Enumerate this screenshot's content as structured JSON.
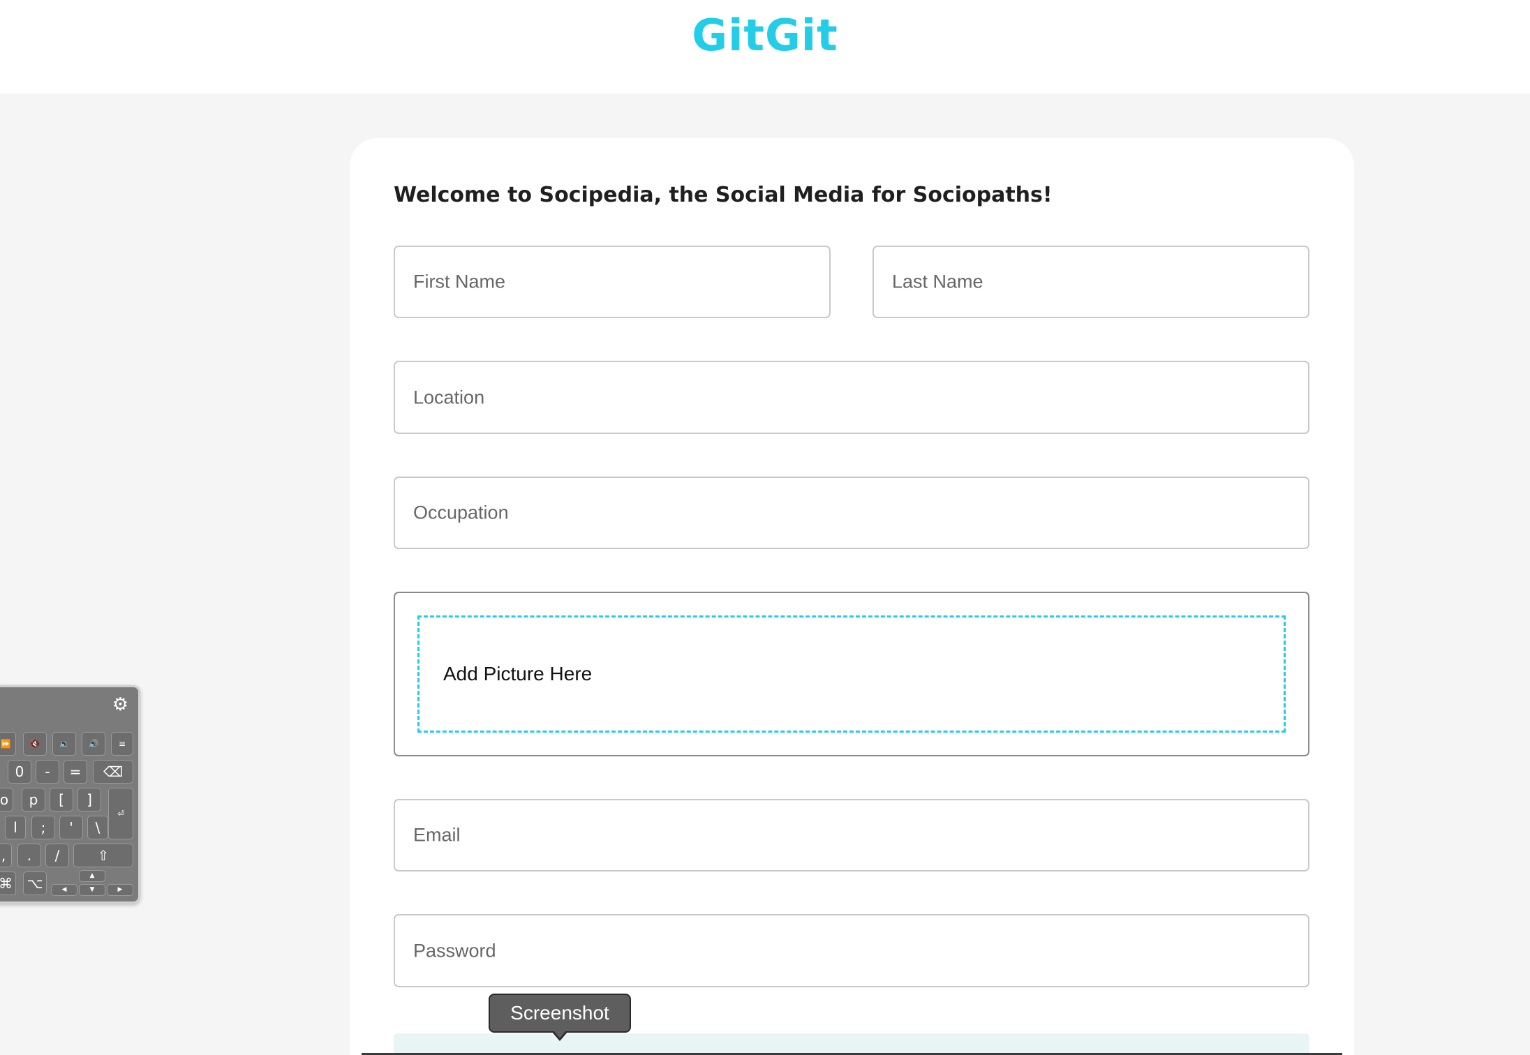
{
  "header": {
    "logo": "GitGit"
  },
  "form": {
    "welcome": "Welcome to Socipedia, the Social Media for Sociopaths!",
    "first_name_placeholder": "First Name",
    "last_name_placeholder": "Last Name",
    "location_placeholder": "Location",
    "occupation_placeholder": "Occupation",
    "picture_label": "Add Picture Here",
    "email_placeholder": "Email",
    "password_placeholder": "Password"
  },
  "keyboard": {
    "row_media": [
      "⏩",
      "🔇",
      "🔉",
      "🔊",
      "≡"
    ],
    "row_numbers": [
      "0",
      "-",
      "=",
      "⌫"
    ],
    "row_top": [
      "o",
      "p",
      "[",
      "]"
    ],
    "row_home": [
      "l",
      ";",
      "'",
      "\\"
    ],
    "row_bottom": [
      ",",
      ".",
      "/",
      "⇧"
    ],
    "row_mod": [
      "⌘",
      "⌥"
    ],
    "arrows": [
      "▲",
      "◀",
      "▼",
      "▶"
    ],
    "return_key": "⏎"
  },
  "tooltip": {
    "label": "Screenshot"
  },
  "colors": {
    "accent": "#23cde8",
    "background": "#f5f5f5"
  }
}
